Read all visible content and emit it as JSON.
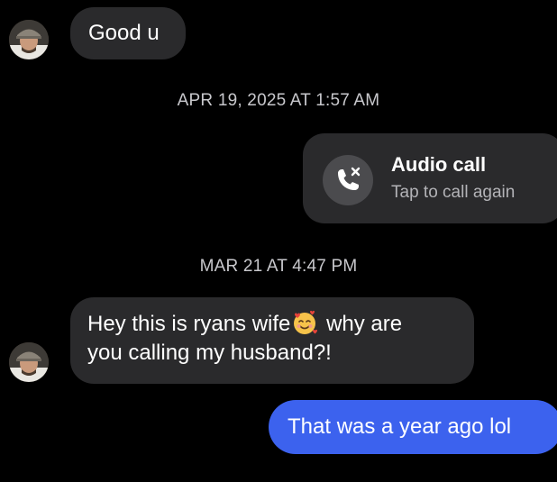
{
  "messages": {
    "first": {
      "text": "Good u"
    },
    "second_line1_before": "Hey this is ryans wife",
    "second_line1_after": " why are",
    "second_line2": "you calling my husband?!",
    "reply": {
      "text": "That was a year ago lol"
    }
  },
  "timestamps": {
    "first": "APR 19, 2025 AT 1:57 AM",
    "second": "MAR 21 AT 4:47 PM"
  },
  "call": {
    "title": "Audio call",
    "subtitle": "Tap to call again",
    "icon": "missed-call-phone-icon"
  },
  "emoji": {
    "name": "smiling-face-with-hearts-emoji"
  },
  "colors": {
    "background": "#000000",
    "incoming_bubble": "#2a2a2c",
    "outgoing_bubble": "#3c62ee",
    "timestamp_text": "#c8c8cc"
  }
}
